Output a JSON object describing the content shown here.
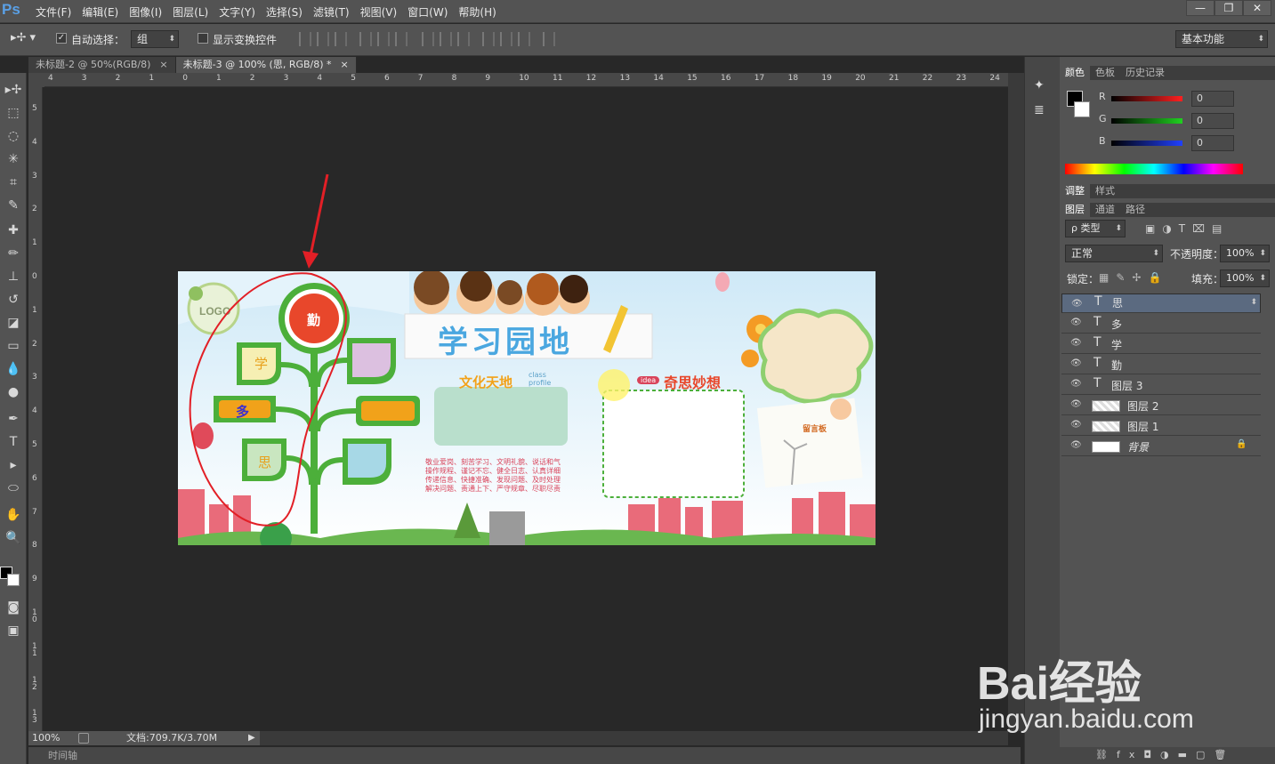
{
  "app": {
    "logo": "Ps"
  },
  "menu": [
    "文件(F)",
    "编辑(E)",
    "图像(I)",
    "图层(L)",
    "文字(Y)",
    "选择(S)",
    "滤镜(T)",
    "视图(V)",
    "窗口(W)",
    "帮助(H)"
  ],
  "window_controls": {
    "minimize": "—",
    "restore": "❐",
    "close": "✕"
  },
  "options": {
    "auto_select_label": "自动选择：",
    "auto_select_value": "组",
    "show_transform_label": "显示变换控件",
    "workspace": "基本功能"
  },
  "tabs": [
    {
      "label": "未标题-2 @ 50%(RGB/8)",
      "close": "×"
    },
    {
      "label": "未标题-3 @ 100% (思, RGB/8) *",
      "close": "×"
    }
  ],
  "ruler_h": [
    "4",
    "3",
    "2",
    "1",
    "0",
    "1",
    "2",
    "3",
    "4",
    "5",
    "6",
    "7",
    "8",
    "9",
    "10",
    "11",
    "12",
    "13",
    "14",
    "15",
    "16",
    "17",
    "18",
    "19",
    "20",
    "21",
    "22",
    "23",
    "24"
  ],
  "ruler_v": [
    "5",
    "4",
    "3",
    "2",
    "1",
    "0",
    "1",
    "2",
    "3",
    "4",
    "5",
    "6",
    "7",
    "8",
    "9",
    "1 0",
    "1 1",
    "1 2",
    "1 3"
  ],
  "status": {
    "zoom": "100%",
    "doc": "文档:709.7K/3.70M",
    "timeline": "时间轴"
  },
  "document": {
    "logo": "LOGO",
    "tree_top": "勤",
    "tree_left": [
      "学",
      "多",
      "思"
    ],
    "banner_title": "学习园地",
    "section1": "文化天地",
    "section1_small": "class profile",
    "section2": "奇思妙想",
    "idea_tag": "idea",
    "board": "留言板",
    "paragraph": [
      "敬业爱岗、刻苦学习、文明礼貌、说话和气",
      "操作规程、谨记不忘、健全日志、认真详细",
      "传递信息、快捷准确、发现问题、及时处理",
      "解决问题、责通上下、严守规章、尽职尽责"
    ]
  },
  "color_panel": {
    "tabs": [
      "颜色",
      "色板",
      "历史记录"
    ],
    "channels": [
      {
        "label": "R",
        "value": "0",
        "color": "#e02020"
      },
      {
        "label": "G",
        "value": "0",
        "color": "#20c020"
      },
      {
        "label": "B",
        "value": "0",
        "color": "#2040e0"
      }
    ]
  },
  "adjust_tabs": [
    "调整",
    "样式"
  ],
  "layers_panel": {
    "tabs": [
      "图层",
      "通道",
      "路径"
    ],
    "filter": "ρ 类型",
    "blend": "正常",
    "opacity_label": "不透明度：",
    "opacity": "100%",
    "lock_label": "锁定：",
    "fill_label": "填充：",
    "fill": "100%",
    "layers": [
      {
        "type": "T",
        "name": "思",
        "selected": true
      },
      {
        "type": "T",
        "name": "多"
      },
      {
        "type": "T",
        "name": "学"
      },
      {
        "type": "T",
        "name": "勤"
      },
      {
        "type": "T",
        "name": "图层 3"
      },
      {
        "type": "img",
        "name": "图层 2"
      },
      {
        "type": "img",
        "name": "图层 1"
      },
      {
        "type": "bg",
        "name": "背景"
      }
    ]
  },
  "watermark": {
    "top": "Bai经验",
    "bottom": "jingyan.baidu.com"
  }
}
